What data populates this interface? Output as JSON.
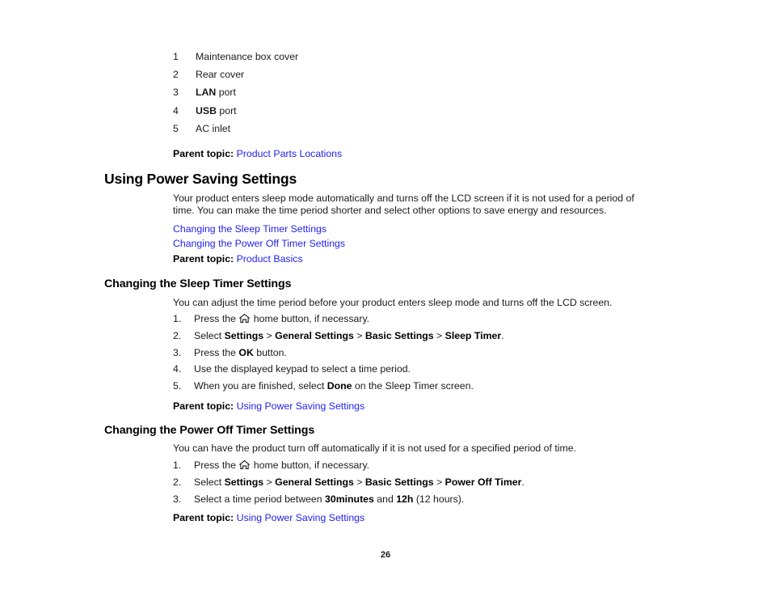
{
  "document": {
    "page_number": "26",
    "link_color": "#2222ee",
    "text_color": "#1a1a1a"
  },
  "parts_list": {
    "items": [
      {
        "num": "1",
        "label": "Maintenance box cover",
        "bold_prefix": "",
        "rest": "Maintenance box cover"
      },
      {
        "num": "2",
        "label": "Rear cover",
        "bold_prefix": "",
        "rest": "Rear cover"
      },
      {
        "num": "3",
        "label": "LAN port",
        "bold_prefix": "LAN",
        "rest": " port"
      },
      {
        "num": "4",
        "label": "USB port",
        "bold_prefix": "USB",
        "rest": " port"
      },
      {
        "num": "5",
        "label": "AC inlet",
        "bold_prefix": "",
        "rest": "AC inlet"
      }
    ]
  },
  "parent_topic_1": {
    "label": "Parent topic:",
    "link": "Product Parts Locations"
  },
  "section_power_saving": {
    "heading": "Using Power Saving Settings",
    "paragraph": "Your product enters sleep mode automatically and turns off the LCD screen if it is not used for a period of time. You can make the time period shorter and select other options to save energy and resources.",
    "links": [
      "Changing the Sleep Timer Settings",
      "Changing the Power Off Timer Settings"
    ],
    "parent_topic": {
      "label": "Parent topic:",
      "link": "Product Basics"
    }
  },
  "section_sleep_timer": {
    "heading": "Changing the Sleep Timer Settings",
    "paragraph": "You can adjust the time period before your product enters sleep mode and turns off the LCD screen.",
    "steps": [
      {
        "num": "1.",
        "parts": [
          {
            "t": "Press the ",
            "b": false
          },
          {
            "t": "home-icon",
            "icon": true
          },
          {
            "t": " home button, if necessary.",
            "b": false
          }
        ]
      },
      {
        "num": "2.",
        "parts": [
          {
            "t": "Select ",
            "b": false
          },
          {
            "t": "Settings",
            "b": true
          },
          {
            "t": " > ",
            "b": false
          },
          {
            "t": "General Settings",
            "b": true
          },
          {
            "t": " > ",
            "b": false
          },
          {
            "t": "Basic Settings",
            "b": true
          },
          {
            "t": " > ",
            "b": false
          },
          {
            "t": "Sleep Timer",
            "b": true
          },
          {
            "t": ".",
            "b": false
          }
        ]
      },
      {
        "num": "3.",
        "parts": [
          {
            "t": "Press the ",
            "b": false
          },
          {
            "t": "OK",
            "b": true
          },
          {
            "t": " button.",
            "b": false
          }
        ]
      },
      {
        "num": "4.",
        "parts": [
          {
            "t": "Use the displayed keypad to select a time period.",
            "b": false
          }
        ]
      },
      {
        "num": "5.",
        "parts": [
          {
            "t": "When you are finished, select ",
            "b": false
          },
          {
            "t": "Done",
            "b": true
          },
          {
            "t": " on the Sleep Timer screen.",
            "b": false
          }
        ]
      }
    ],
    "parent_topic": {
      "label": "Parent topic:",
      "link": "Using Power Saving Settings"
    }
  },
  "section_power_off_timer": {
    "heading": "Changing the Power Off Timer Settings",
    "paragraph": "You can have the product turn off automatically if it is not used for a specified period of time.",
    "steps": [
      {
        "num": "1.",
        "parts": [
          {
            "t": "Press the ",
            "b": false
          },
          {
            "t": "home-icon",
            "icon": true
          },
          {
            "t": " home button, if necessary.",
            "b": false
          }
        ]
      },
      {
        "num": "2.",
        "parts": [
          {
            "t": "Select ",
            "b": false
          },
          {
            "t": "Settings",
            "b": true
          },
          {
            "t": " > ",
            "b": false
          },
          {
            "t": "General Settings",
            "b": true
          },
          {
            "t": " > ",
            "b": false
          },
          {
            "t": "Basic Settings",
            "b": true
          },
          {
            "t": " > ",
            "b": false
          },
          {
            "t": "Power Off Timer",
            "b": true
          },
          {
            "t": ".",
            "b": false
          }
        ]
      },
      {
        "num": "3.",
        "parts": [
          {
            "t": "Select a time period between ",
            "b": false
          },
          {
            "t": "30minutes",
            "b": true
          },
          {
            "t": " and ",
            "b": false
          },
          {
            "t": "12h",
            "b": true
          },
          {
            "t": " (12 hours).",
            "b": false
          }
        ]
      }
    ],
    "parent_topic": {
      "label": "Parent topic:",
      "link": "Using Power Saving Settings"
    }
  }
}
